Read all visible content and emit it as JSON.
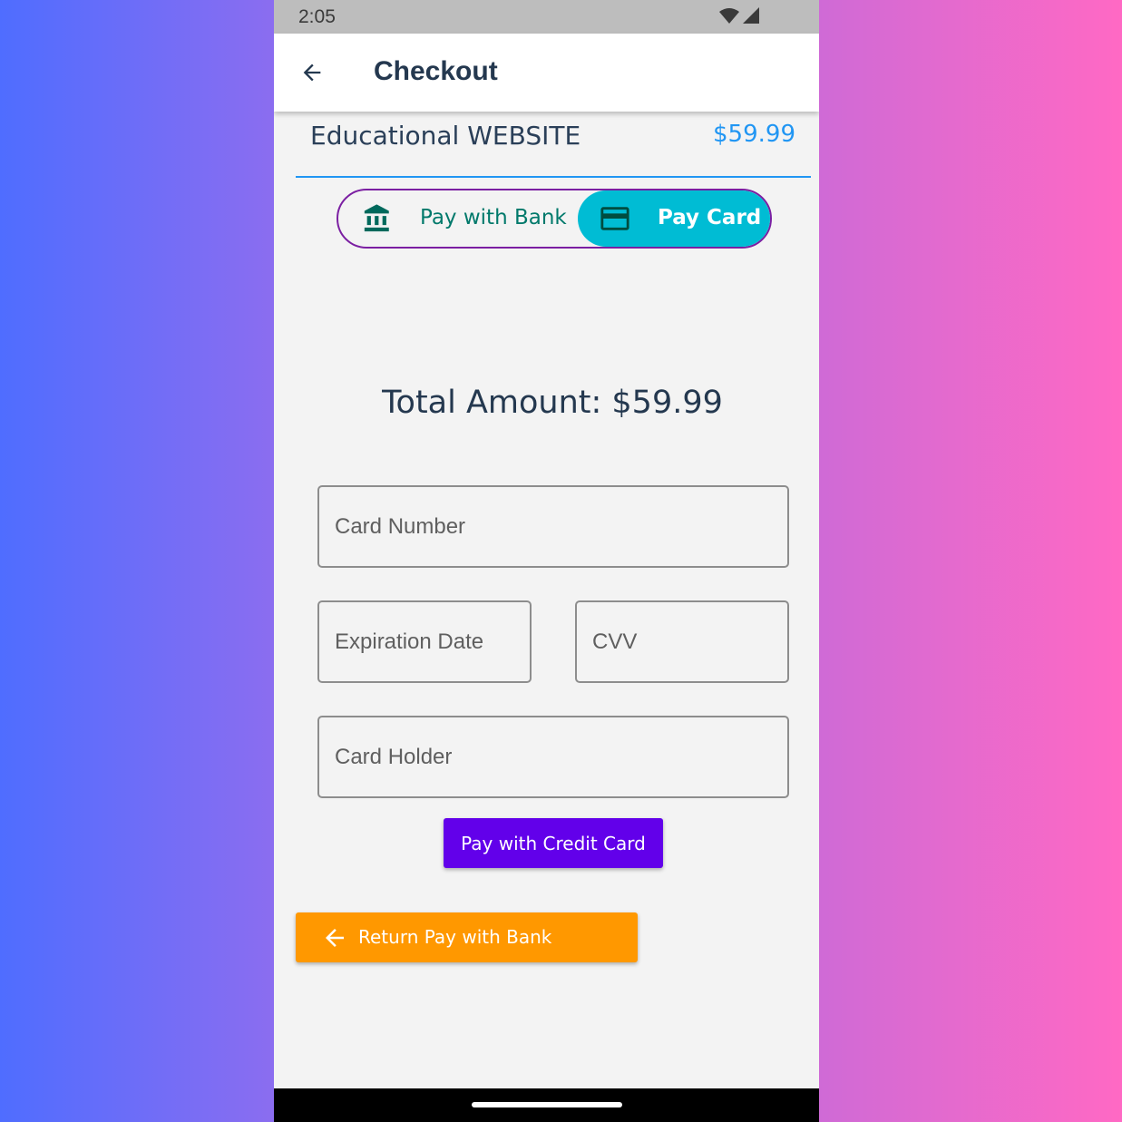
{
  "status_bar": {
    "time": "2:05",
    "icons": [
      "wifi-icon",
      "cell-signal-icon"
    ]
  },
  "app_bar": {
    "title": "Checkout",
    "back_icon": "arrow-back-icon"
  },
  "product": {
    "name": "Educational WEBSITE",
    "price": "$59.99"
  },
  "payment_toggle": {
    "bank": {
      "label": "Pay with Bank",
      "icon": "bank-icon"
    },
    "card": {
      "label": "Pay Card",
      "icon": "credit-card-icon",
      "selected": true
    }
  },
  "total": {
    "text": "Total Amount: $59.99"
  },
  "form": {
    "card_number": {
      "placeholder": "Card Number",
      "value": ""
    },
    "expiration_date": {
      "placeholder": "Expiration Date",
      "value": ""
    },
    "cvv": {
      "placeholder": "CVV",
      "value": ""
    },
    "card_holder": {
      "placeholder": "Card Holder",
      "value": ""
    }
  },
  "buttons": {
    "pay_credit_card": "Pay with Credit Card",
    "return_bank": "Return Pay with Bank",
    "return_icon": "arrow-back-icon"
  },
  "colors": {
    "title": "#24384f",
    "price": "#2196f3",
    "toggle_border": "#7b1fa2",
    "toggle_selected": "#00bcd4",
    "bank_label": "#00796b",
    "pay_button": "#6200ea",
    "return_button": "#ff9800"
  }
}
